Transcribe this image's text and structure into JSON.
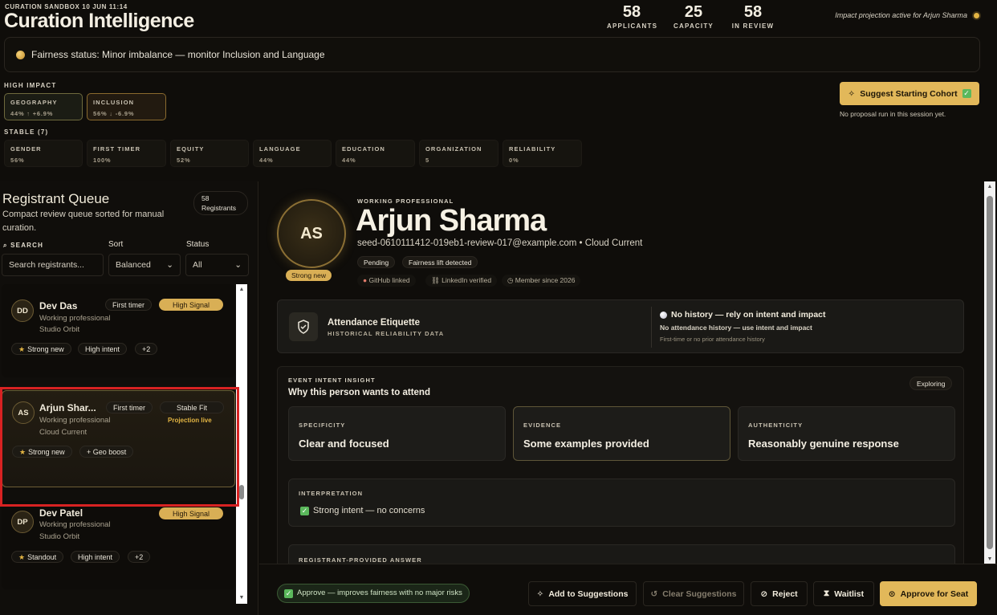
{
  "header": {
    "session": "CURATION SANDBOX 10 JUN 11:14",
    "title": "Curation Intelligence",
    "stats": [
      {
        "value": "58",
        "label": "APPLICANTS"
      },
      {
        "value": "25",
        "label": "CAPACITY"
      },
      {
        "value": "58",
        "label": "IN REVIEW"
      }
    ],
    "projection": "Impact projection active for Arjun Sharma"
  },
  "fairness": {
    "status": "Fairness status: Minor imbalance — monitor Inclusion and Language"
  },
  "high_impact": {
    "label": "HIGH IMPACT",
    "items": [
      {
        "name": "GEOGRAPHY",
        "value": "44% ↑ +6.9%"
      },
      {
        "name": "INCLUSION",
        "value": "56% ↓ -6.9%"
      }
    ]
  },
  "stable": {
    "label": "STABLE (7)",
    "items": [
      {
        "name": "GENDER",
        "value": "56%"
      },
      {
        "name": "FIRST TIMER",
        "value": "100%"
      },
      {
        "name": "EQUITY",
        "value": "52%"
      },
      {
        "name": "LANGUAGE",
        "value": "44%"
      },
      {
        "name": "EDUCATION",
        "value": "44%"
      },
      {
        "name": "ORGANIZATION",
        "value": "5"
      },
      {
        "name": "RELIABILITY",
        "value": "0%"
      }
    ]
  },
  "suggest": {
    "button": "Suggest Starting Cohort",
    "note": "No proposal run in this session yet."
  },
  "queue": {
    "title": "Registrant Queue",
    "subtitle": "Compact review queue sorted for manual curation.",
    "count_num": "58",
    "count_label": "Registrants",
    "search_label": "SEARCH",
    "search_placeholder": "Search registrants...",
    "sort_label": "Sort",
    "sort_value": "Balanced",
    "status_label": "Status",
    "status_value": "All",
    "cards": [
      {
        "initials": "DD",
        "name": "Dev Das",
        "role": "Working professional",
        "org": "Studio Orbit",
        "badge1": "First timer",
        "badge2": "High Signal",
        "tags": [
          "Strong new",
          "High intent",
          "+2"
        ]
      },
      {
        "initials": "AS",
        "name": "Arjun Shar...",
        "role": "Working professional",
        "org": "Cloud Current",
        "badge1": "First timer",
        "badge2": "Stable Fit",
        "live": "Projection live",
        "tags": [
          "Strong new",
          "+ Geo boost"
        ]
      },
      {
        "initials": "DP",
        "name": "Dev Patel",
        "role": "Working professional",
        "org": "Studio Orbit",
        "badge2": "High Signal",
        "tags": [
          "Standout",
          "High intent",
          "+2"
        ]
      }
    ]
  },
  "profile": {
    "initials": "AS",
    "badge": "Strong new",
    "role_tag": "WORKING PROFESSIONAL",
    "name": "Arjun Sharma",
    "meta": "seed-0610111412-019eb1-review-017@example.com • Cloud Current",
    "tags": [
      "Pending",
      "Fairness lift detected"
    ],
    "links": [
      "GitHub linked",
      "LinkedIn verified",
      "Member since 2026"
    ]
  },
  "attendance": {
    "title": "Attendance Etiquette",
    "subtitle": "HISTORICAL RELIABILITY DATA",
    "status": "No history — rely on intent and impact",
    "detail": "No attendance history — use intent and impact",
    "note": "First-time or no prior attendance history"
  },
  "intent": {
    "tag": "EVENT INTENT INSIGHT",
    "title": "Why this person wants to attend",
    "status": "Exploring",
    "cards": [
      {
        "label": "SPECIFICITY",
        "value": "Clear and focused"
      },
      {
        "label": "EVIDENCE",
        "value": "Some examples provided"
      },
      {
        "label": "AUTHENTICITY",
        "value": "Reasonably genuine response"
      }
    ],
    "interp_label": "INTERPRETATION",
    "interp_value": "Strong intent — no concerns",
    "answer_label": "REGISTRANT-PROVIDED ANSWER"
  },
  "actions": {
    "note": "Approve — improves fairness with no major risks",
    "add": "Add to Suggestions",
    "clear": "Clear Suggestions",
    "reject": "Reject",
    "waitlist": "Waitlist",
    "approve": "Approve for Seat"
  },
  "colors": {
    "accent": "#e2b85a",
    "highlight": "#d82222"
  }
}
